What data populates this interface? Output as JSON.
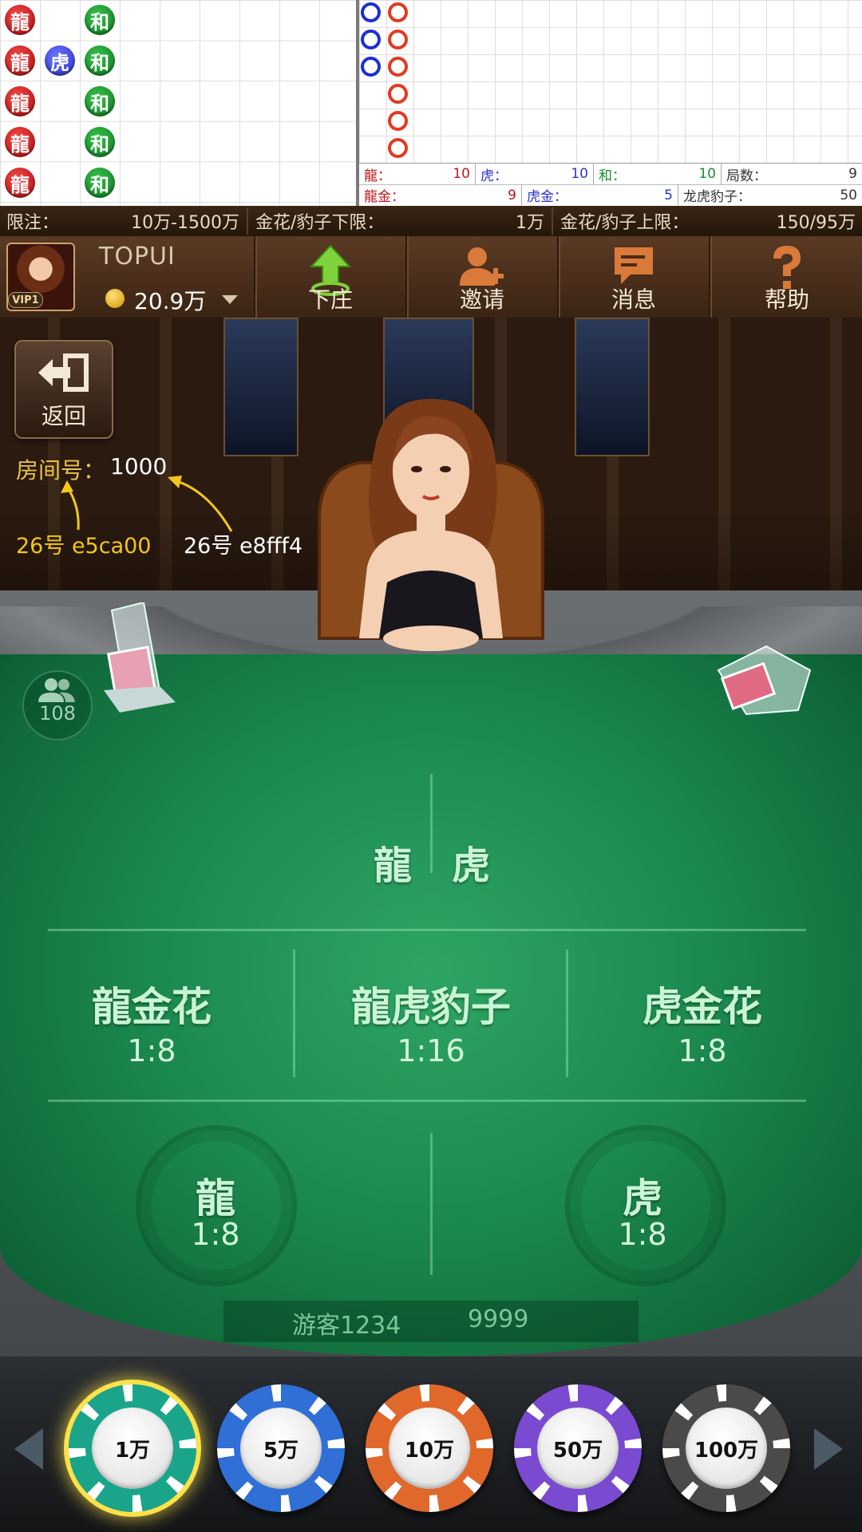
{
  "colors": {
    "dragon": "#c21515",
    "tiger": "#2e33c8",
    "tie": "#139127",
    "felt": "#1c8a4f",
    "highlight": "#ffe24a"
  },
  "roadmap": {
    "big_road": [
      [
        "龍",
        "",
        "和"
      ],
      [
        "龍",
        "虎",
        "和"
      ],
      [
        "龍",
        "",
        "和"
      ],
      [
        "龍",
        "",
        "和"
      ],
      [
        "龍",
        "",
        "和"
      ]
    ],
    "bead_road": {
      "col1": [
        "blue",
        "blue",
        "blue"
      ],
      "col2": [
        "red",
        "red",
        "red",
        "red",
        "red",
        "red"
      ]
    },
    "stats": {
      "dragon_label": "龍：",
      "dragon_value": "10",
      "tiger_label": "虎：",
      "tiger_value": "10",
      "tie_label": "和：",
      "tie_value": "10",
      "rounds_label": "局数：",
      "rounds_value": "9",
      "dragon_gold_label": "龍金：",
      "dragon_gold_value": "9",
      "tiger_gold_label": "虎金：",
      "tiger_gold_value": "5",
      "leopard_label": "龙虎豹子：",
      "leopard_value": "50"
    }
  },
  "limits": {
    "limit_label": "限注：",
    "limit_value": "10万-1500万",
    "min_label": "金花/豹子下限：",
    "min_value": "1万",
    "max_label": "金花/豹子上限：",
    "max_value": "150/95万"
  },
  "player": {
    "vip": "VIP1",
    "name": "TOPUI",
    "balance": "20.9万"
  },
  "toolbar": {
    "banker": "下庄",
    "invite": "邀请",
    "message": "消息",
    "help": "帮助"
  },
  "room": {
    "back": "返回",
    "room_label": "房间号：",
    "room_number": "1000",
    "annotation_left": "26号 e5ca00",
    "annotation_right": "26号 e8fff4"
  },
  "online_count": "108",
  "bets": {
    "dragon_tiger": {
      "dragon": "龍",
      "tiger": "虎"
    },
    "dragon_golden": {
      "label": "龍金花",
      "odds": "1:8"
    },
    "leopard": {
      "label": "龍虎豹子",
      "odds": "1:16"
    },
    "tiger_golden": {
      "label": "虎金花",
      "odds": "1:8"
    },
    "dragon": {
      "label": "龍",
      "odds": "1:8"
    },
    "tiger": {
      "label": "虎",
      "odds": "1:8"
    }
  },
  "guest": {
    "name": "游客1234",
    "value": "9999"
  },
  "chips": [
    {
      "label": "1万",
      "color": "#1aa58a",
      "selected": true
    },
    {
      "label": "5万",
      "color": "#2f6fd6",
      "selected": false
    },
    {
      "label": "10万",
      "color": "#e0682a",
      "selected": false
    },
    {
      "label": "50万",
      "color": "#7a4ad0",
      "selected": false
    },
    {
      "label": "100万",
      "color": "#4a4a4a",
      "selected": false
    }
  ]
}
